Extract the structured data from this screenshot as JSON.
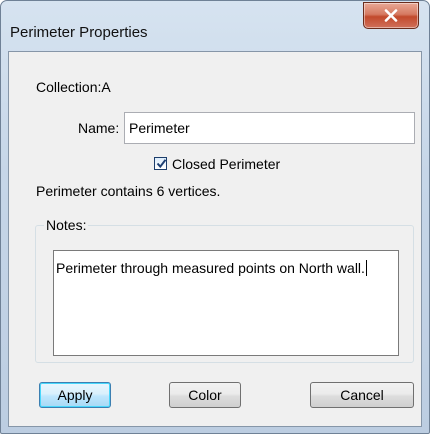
{
  "window": {
    "title": "Perimeter Properties"
  },
  "form": {
    "collection_label": "Collection:",
    "collection_value": "A",
    "name_label": "Name:",
    "name_value": "Perimeter",
    "closed_checkbox_label": "Closed Perimeter",
    "closed_checked": true,
    "vertices_text": "Perimeter contains 6 vertices."
  },
  "notes": {
    "legend": "Notes:",
    "text": "Perimeter through measured points on North wall."
  },
  "buttons": {
    "apply": "Apply",
    "color": "Color",
    "cancel": "Cancel"
  },
  "icons": {
    "close": "close-icon",
    "check": "checkmark-icon"
  },
  "colors": {
    "close_button": "#c24a2c",
    "default_button_border": "#3c7fb1",
    "window_frame": "#c6d6e8"
  }
}
